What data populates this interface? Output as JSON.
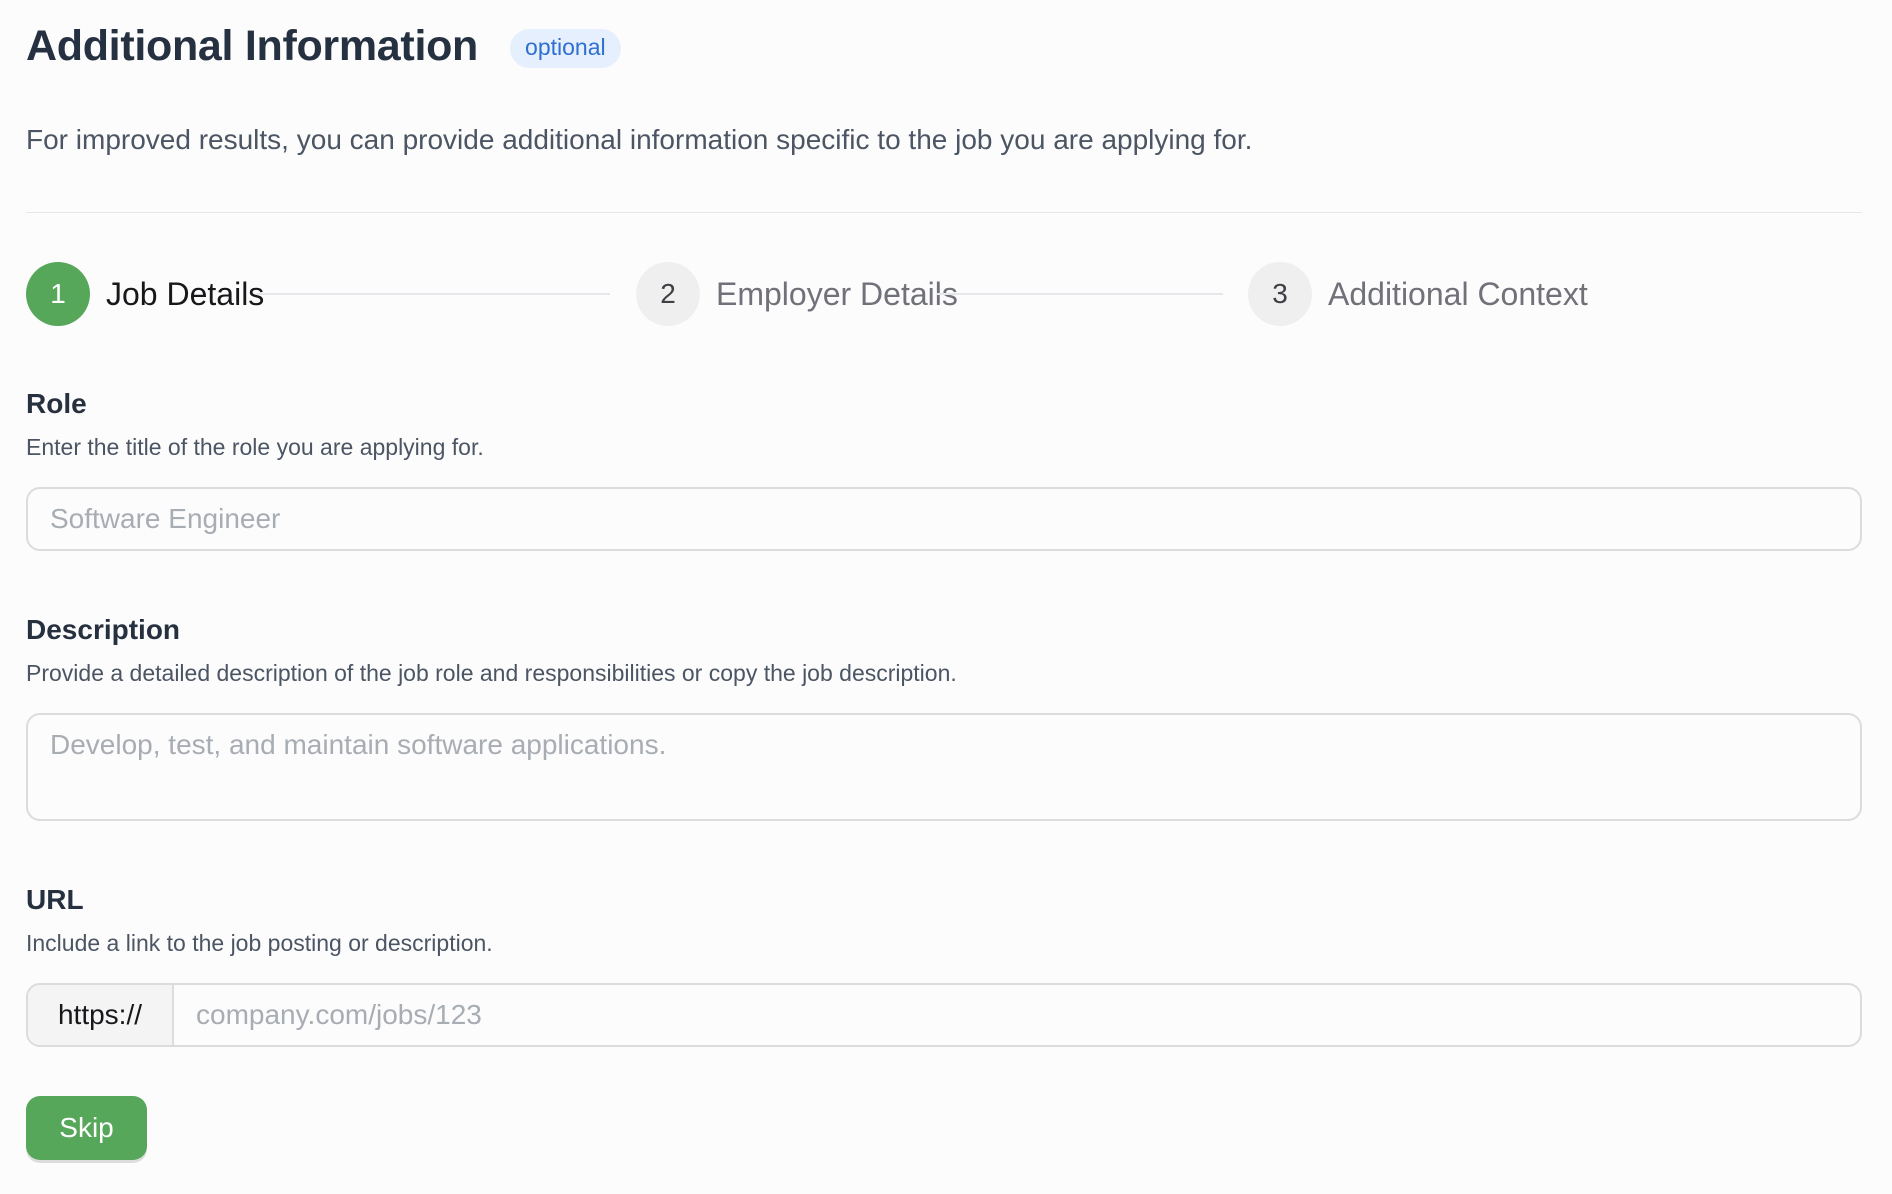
{
  "header": {
    "title": "Additional Information",
    "badge": "optional"
  },
  "intro": "For improved results, you can provide additional information specific to the job you are applying for.",
  "stepper": {
    "steps": [
      {
        "number": "1",
        "label": "Job Details",
        "active": true
      },
      {
        "number": "2",
        "label": "Employer Details",
        "active": false
      },
      {
        "number": "3",
        "label": "Additional Context",
        "active": false
      }
    ],
    "active_color": "#56a75a"
  },
  "fields": {
    "role": {
      "label": "Role",
      "help": "Enter the title of the role you are applying for.",
      "value": "",
      "placeholder": "Software Engineer"
    },
    "description": {
      "label": "Description",
      "help": "Provide a detailed description of the job role and responsibilities or copy the job description.",
      "value": "",
      "placeholder": "Develop, test, and maintain software applications."
    },
    "url": {
      "label": "URL",
      "help": "Include a link to the job posting or description.",
      "prefix": "https://",
      "value": "",
      "placeholder": "company.com/jobs/123"
    }
  },
  "actions": {
    "skip_label": "Skip"
  },
  "colors": {
    "accent": "#56a75a",
    "badge_bg": "#e5effd",
    "badge_text": "#2f6fd0"
  }
}
